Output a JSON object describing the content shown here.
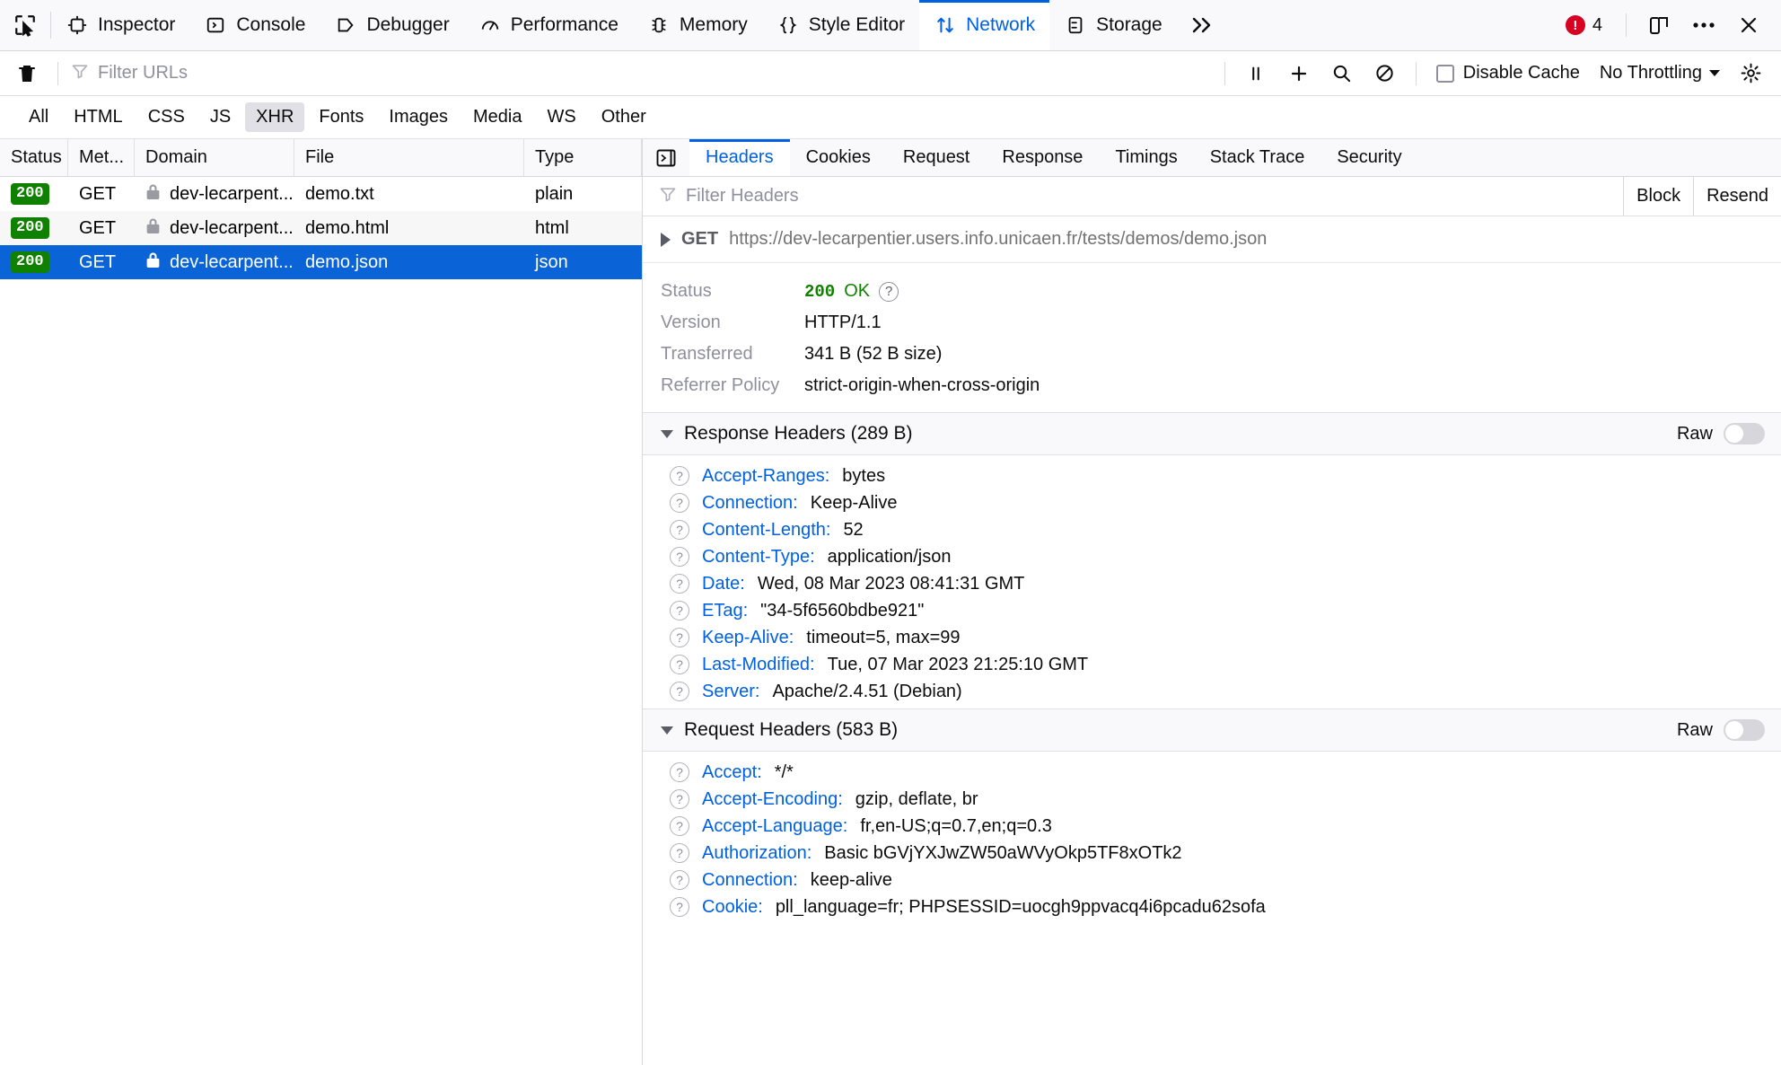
{
  "toolbox": {
    "picker_icon": "element-picker-icon",
    "tabs": [
      {
        "label": "Inspector",
        "icon": "inspector-icon",
        "selected": false
      },
      {
        "label": "Console",
        "icon": "console-icon",
        "selected": false
      },
      {
        "label": "Debugger",
        "icon": "debugger-icon",
        "selected": false
      },
      {
        "label": "Performance",
        "icon": "performance-icon",
        "selected": false
      },
      {
        "label": "Memory",
        "icon": "memory-icon",
        "selected": false
      },
      {
        "label": "Style Editor",
        "icon": "style-editor-icon",
        "selected": false
      },
      {
        "label": "Network",
        "icon": "network-icon",
        "selected": true
      },
      {
        "label": "Storage",
        "icon": "storage-icon",
        "selected": false
      }
    ],
    "overflow_label": "»",
    "error_count": "4",
    "responsive_icon": "responsive-design-mode-icon",
    "meatball_icon": "more-options-icon",
    "close_icon": "close-icon"
  },
  "net_toolbar": {
    "clear_icon": "trash-icon",
    "filter_icon": "funnel-icon",
    "filter_placeholder": "Filter URLs",
    "pause_icon": "pause-icon",
    "new_request_icon": "plus-icon",
    "search_icon": "search-icon",
    "block_icon": "no-entry-icon",
    "disable_cache_label": "Disable Cache",
    "throttling_label": "No Throttling",
    "settings_icon": "gear-icon"
  },
  "type_filters": {
    "items": [
      "All",
      "HTML",
      "CSS",
      "JS",
      "XHR",
      "Fonts",
      "Images",
      "Media",
      "WS",
      "Other"
    ],
    "active": "XHR"
  },
  "request_list": {
    "columns": [
      "Status",
      "Met...",
      "Domain",
      "File",
      "Type"
    ],
    "rows": [
      {
        "status": "200",
        "method": "GET",
        "domain": "dev-lecarpent...",
        "file": "demo.txt",
        "type": "plain",
        "lock": "lock-icon",
        "selected": false
      },
      {
        "status": "200",
        "method": "GET",
        "domain": "dev-lecarpent...",
        "file": "demo.html",
        "type": "html",
        "lock": "lock-icon",
        "selected": false
      },
      {
        "status": "200",
        "method": "GET",
        "domain": "dev-lecarpent...",
        "file": "demo.json",
        "type": "json",
        "lock": "lock-icon",
        "selected": true
      }
    ]
  },
  "details": {
    "pane_toggle_icon": "toggle-request-list-icon",
    "tabs": [
      {
        "label": "Headers",
        "selected": true
      },
      {
        "label": "Cookies",
        "selected": false
      },
      {
        "label": "Request",
        "selected": false
      },
      {
        "label": "Response",
        "selected": false
      },
      {
        "label": "Timings",
        "selected": false
      },
      {
        "label": "Stack Trace",
        "selected": false
      },
      {
        "label": "Security",
        "selected": false
      }
    ],
    "filter_icon": "funnel-icon",
    "filter_placeholder": "Filter Headers",
    "block_button": "Block",
    "resend_button": "Resend",
    "url_row": {
      "expander_icon": "triangle-right-icon",
      "method": "GET",
      "url": "https://dev-lecarpentier.users.info.unicaen.fr/tests/demos/demo.json"
    },
    "summary": [
      {
        "label": "Status",
        "value": "200",
        "value2": "OK",
        "help": "help-icon",
        "status": true
      },
      {
        "label": "Version",
        "value": "HTTP/1.1"
      },
      {
        "label": "Transferred",
        "value": "341 B (52 B size)"
      },
      {
        "label": "Referrer Policy",
        "value": "strict-origin-when-cross-origin"
      }
    ],
    "response_headers": {
      "title": "Response Headers (289 B)",
      "raw_label": "Raw",
      "items": [
        {
          "name": "Accept-Ranges:",
          "value": "bytes"
        },
        {
          "name": "Connection:",
          "value": "Keep-Alive"
        },
        {
          "name": "Content-Length:",
          "value": "52"
        },
        {
          "name": "Content-Type:",
          "value": "application/json"
        },
        {
          "name": "Date:",
          "value": "Wed, 08 Mar 2023 08:41:31 GMT"
        },
        {
          "name": "ETag:",
          "value": "\"34-5f6560bdbe921\""
        },
        {
          "name": "Keep-Alive:",
          "value": "timeout=5, max=99"
        },
        {
          "name": "Last-Modified:",
          "value": "Tue, 07 Mar 2023 21:25:10 GMT"
        },
        {
          "name": "Server:",
          "value": "Apache/2.4.51 (Debian)"
        }
      ]
    },
    "request_headers": {
      "title": "Request Headers (583 B)",
      "raw_label": "Raw",
      "items": [
        {
          "name": "Accept:",
          "value": "*/*"
        },
        {
          "name": "Accept-Encoding:",
          "value": "gzip, deflate, br"
        },
        {
          "name": "Accept-Language:",
          "value": "fr,en-US;q=0.7,en;q=0.3"
        },
        {
          "name": "Authorization:",
          "value": "Basic bGVjYXJwZW50aWVyOkp5TF8xOTk2"
        },
        {
          "name": "Connection:",
          "value": "keep-alive"
        },
        {
          "name": "Cookie:",
          "value": "pll_language=fr; PHPSESSID=uocgh9ppvacq4i6pcadu62sofa"
        }
      ]
    }
  },
  "colors": {
    "accent": "#0061e0",
    "selected_row": "#0a64d8",
    "status_green": "#108000",
    "error_red": "#d70022",
    "header_name_blue": "#0061e0"
  }
}
